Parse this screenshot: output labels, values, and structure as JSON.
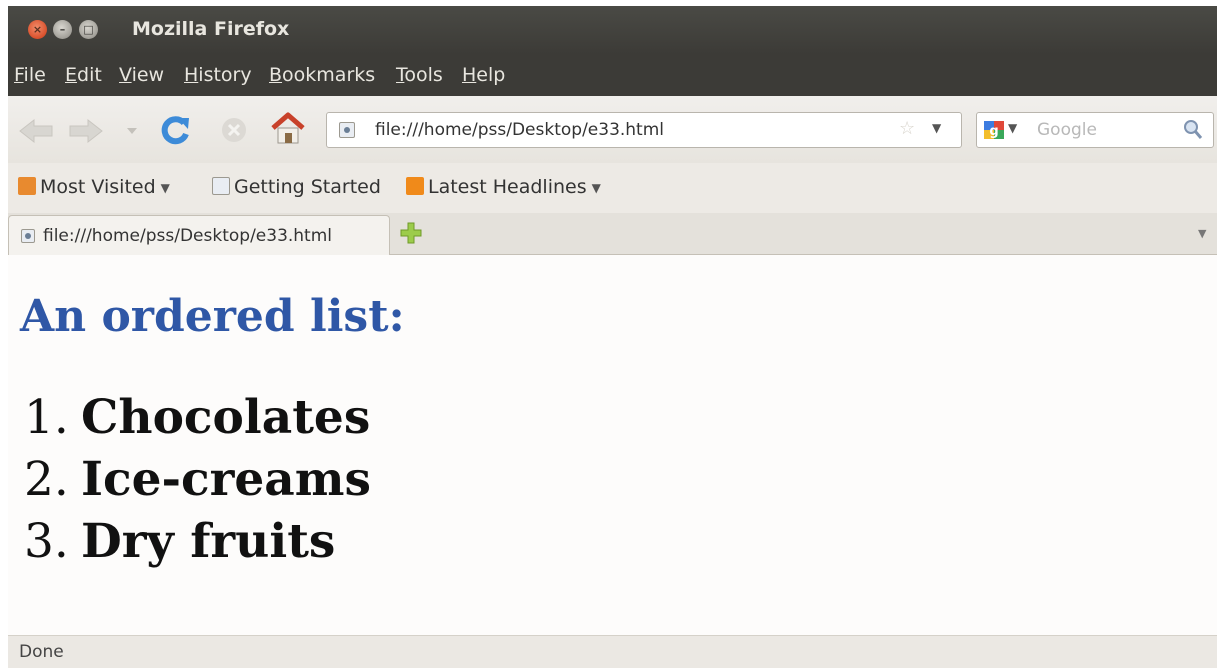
{
  "window": {
    "title": "Mozilla Firefox"
  },
  "menu": [
    "File",
    "Edit",
    "View",
    "History",
    "Bookmarks",
    "Tools",
    "Help"
  ],
  "nav": {
    "url": "file:///home/pss/Desktop/e33.html",
    "search_placeholder": "Google",
    "icons": [
      "back-arrow-icon",
      "forward-arrow-icon",
      "reload-icon",
      "stop-icon",
      "home-icon"
    ]
  },
  "bookmarks": {
    "items": [
      {
        "label": "Most Visited",
        "icon": "folder-icon",
        "dropdown": true
      },
      {
        "label": "Getting Started",
        "icon": "page-icon",
        "dropdown": false
      },
      {
        "label": "Latest Headlines",
        "icon": "rss-icon",
        "dropdown": true
      }
    ]
  },
  "tabs": [
    {
      "label": "file:///home/pss/Desktop/e33.html",
      "active": true
    }
  ],
  "page": {
    "heading": "An ordered list:",
    "list": [
      {
        "number": "1.",
        "text": "Chocolates"
      },
      {
        "number": "2.",
        "text": "Ice-creams"
      },
      {
        "number": "3.",
        "text": "Dry fruits"
      }
    ]
  },
  "status": "Done",
  "colors": {
    "heading": "#2f57a6",
    "titlebar": "#3c3b37",
    "close_button": "#d8502c"
  }
}
